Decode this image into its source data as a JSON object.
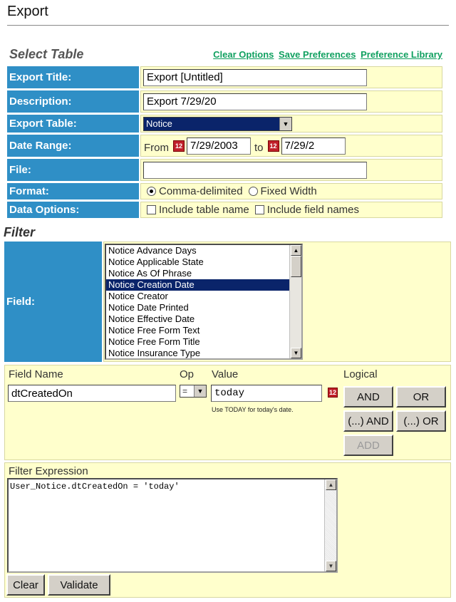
{
  "page": {
    "title": "Export"
  },
  "select_table": {
    "heading": "Select Table",
    "links": {
      "clear": "Clear Options",
      "save": "Save Preferences",
      "library": "Preference Library"
    },
    "rows": {
      "export_title": {
        "label": "Export Title:",
        "value": "Export [Untitled]"
      },
      "description": {
        "label": "Description:",
        "value": "Export 7/29/20"
      },
      "export_table": {
        "label": "Export Table:",
        "selected": "Notice"
      },
      "date_range": {
        "label": "Date Range:",
        "from_label": "From",
        "from_value": "7/29/2003",
        "to_label": "to",
        "to_value": "7/29/2"
      },
      "file": {
        "label": "File:",
        "value": ""
      },
      "format": {
        "label": "Format:",
        "opt1": "Comma-delimited",
        "opt2": "Fixed Width"
      },
      "data_options": {
        "label": "Data Options:",
        "opt1": "Include table name",
        "opt2": "Include field names"
      }
    },
    "calendar_icon_text": "12"
  },
  "filter": {
    "heading": "Filter",
    "field_label": "Field:",
    "fields": [
      "Notice Advance Days",
      "Notice Applicable State",
      "Notice As Of Phrase",
      "Notice Creation Date",
      "Notice Creator",
      "Notice Date Printed",
      "Notice Effective Date",
      "Notice Free Form Text",
      "Notice Free Form Title",
      "Notice Insurance Type"
    ],
    "selected_index": 3,
    "headers": {
      "field_name": "Field Name",
      "op": "Op",
      "value": "Value",
      "logical": "Logical"
    },
    "field_name_value": "dtCreatedOn",
    "op_value": "=",
    "value_value": "today",
    "hint": "Use TODAY for today's date.",
    "buttons": {
      "and": "AND",
      "or": "OR",
      "p_and": "(...) AND",
      "p_or": "(...) OR",
      "add": "ADD"
    },
    "expression_label": "Filter Expression",
    "expression": "User_Notice.dtCreatedOn = 'today'",
    "clear": "Clear",
    "validate": "Validate"
  }
}
